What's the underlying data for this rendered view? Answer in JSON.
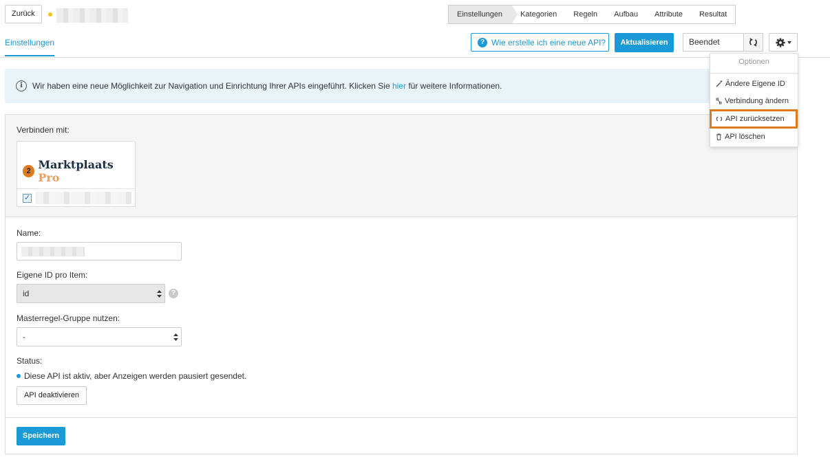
{
  "topbar": {
    "back_label": "Zurück",
    "wizard_steps": [
      "Einstellungen",
      "Kategorien",
      "Regeln",
      "Aufbau",
      "Attribute",
      "Resultat"
    ],
    "active_step": "Einstellungen"
  },
  "tabs": {
    "settings": "Einstellungen"
  },
  "actions": {
    "help_label": "Wie erstelle ich eine neue API?",
    "refresh_label": "Aktualisieren",
    "state_value": "Beendet"
  },
  "options_menu": {
    "header": "Optionen",
    "items": [
      "Ändere Eigene ID",
      "Verbindung ändern",
      "API zurücksetzen",
      "API löschen"
    ],
    "highlighted_item": "API zurücksetzen",
    "highlight_color": "#e07a1f"
  },
  "info": {
    "text_before": "Wir haben eine neue Möglichkeit zur Navigation und Einrichtung Ihrer APIs eingeführt. Klicken Sie ",
    "link": "hier",
    "text_after": " für weitere Informationen."
  },
  "connect": {
    "label": "Verbinden mit:",
    "logo_name": "Marktplaats",
    "logo_suffix": "Pro",
    "checked": true
  },
  "form": {
    "name_label": "Name:",
    "own_id_label": "Eigene ID pro Item:",
    "own_id_value": "id",
    "master_label": "Masterregel-Gruppe nutzen:",
    "master_value": "-",
    "status_label": "Status:",
    "status_text": "Diese API ist aktiv, aber Anzeigen werden pausiert gesendet.",
    "deactivate_label": "API deaktivieren",
    "save_label": "Speichern"
  },
  "colors": {
    "accent": "#1a9ad6",
    "status_dot": "#f0c419"
  }
}
